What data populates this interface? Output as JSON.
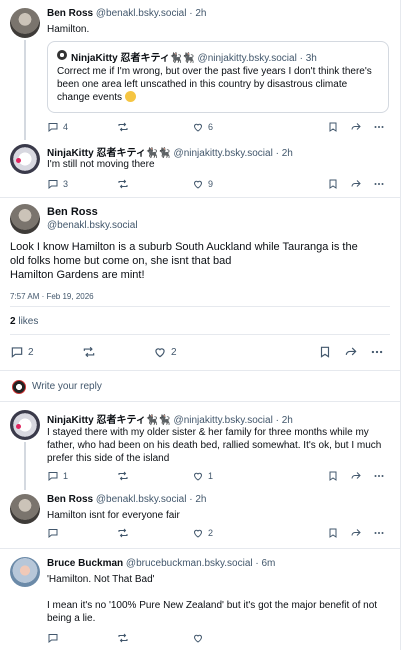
{
  "posts": [
    {
      "name": "Ben Ross",
      "handle": "@benakl.bsky.social",
      "time": "· 2h",
      "text": "Hamilton.",
      "quote": {
        "name": "NinjaKitty 忍者キティ🐈‍⬛🐈‍⬛",
        "handle": "@ninjakitty.bsky.social",
        "time": "· 3h",
        "text": "Correct me if I'm wrong, but over the past five years I don't think there's been one area left unscathed in this country by disastrous climate change events"
      },
      "reply_count": "4",
      "like_count": "6"
    },
    {
      "name": "NinjaKitty 忍者キティ🐈‍⬛🐈‍⬛",
      "handle": "@ninjakitty.bsky.social",
      "time": "· 2h",
      "text": "I'm still not moving there",
      "reply_count": "3",
      "like_count": "9"
    }
  ],
  "anchor": {
    "name": "Ben Ross",
    "handle": "@benakl.bsky.social",
    "text_lines": [
      "Look I know Hamilton is a suburb South Auckland while Tauranga is the",
      "old folks home but come on, she isnt that bad",
      "Hamilton Gardens are mint!"
    ],
    "date": "7:57 AM · Feb 19, 2026",
    "likes_count": "2",
    "likes_label": "likes",
    "reply_count": "2",
    "like_count": "2"
  },
  "reply_prompt": "Write your reply",
  "replies": [
    {
      "name": "NinjaKitty 忍者キティ🐈‍⬛🐈‍⬛",
      "handle": "@ninjakitty.bsky.social",
      "time": "· 2h",
      "text": "I stayed there with my older sister & her family for three months while my father, who had been on his death bed, rallied somewhat. It's ok, but I much prefer this side of the island",
      "reply_count": "1",
      "like_count": "1"
    },
    {
      "name": "Ben Ross",
      "handle": "@benakl.bsky.social",
      "time": "· 2h",
      "text": "Hamilton isnt for everyone fair",
      "reply_count": "",
      "like_count": "2"
    },
    {
      "name": "Bruce Buckman",
      "handle": "@brucebuckman.bsky.social",
      "time": "· 6m",
      "text_lines": [
        "'Hamilton. Not That Bad'",
        "",
        "I mean it's no '100% Pure New Zealand' but it's got the major benefit of not being a lie."
      ]
    }
  ]
}
